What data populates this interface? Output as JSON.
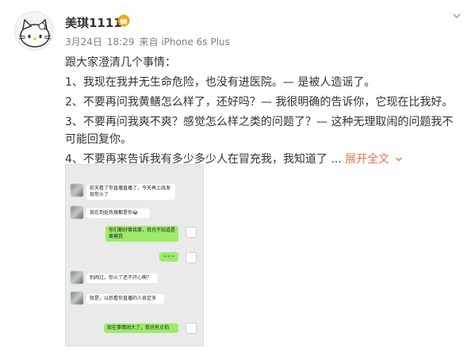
{
  "post": {
    "username": "美琪1111",
    "date": "3月24日",
    "time": "18:29",
    "source": "来自 iPhone 6s Plus",
    "lines": [
      "跟大家澄清几个事情：",
      "1、我现在我并无生命危险，也没有进医院。— 是被人造谣了。",
      "2、不要再问我黄鳝怎么样了，还好吗？— 我很明确的告诉你，它现在比我好。",
      "3、不要再问我爽不爽？感觉怎么样之类的问题了？— 这种无理取闹的问题我不可能回复你。",
      "4、不要再来告诉我有多少多少人在冒充我，我知道了"
    ],
    "ellipsis": "...",
    "expand_label": "展开全文",
    "icons": {
      "avatar": "hello-kitty-avatar-icon",
      "badge": "vip-crown-icon",
      "menu": "chevron-down-icon",
      "expand": "chevron-down-icon"
    },
    "colors": {
      "link": "#eb7350",
      "meta": "#808080",
      "text": "#333333"
    }
  },
  "chat": {
    "messages": [
      {
        "side": "in",
        "text": "前天看了你直播直播了，今天再上线发现你火了"
      },
      {
        "side": "in",
        "text": "现在到处热搜都是你😂"
      },
      {
        "side": "out",
        "text": "你们都好事找事，我也不知道是黄鳝我"
      },
      {
        "side": "out",
        "text": "~~~"
      },
      {
        "side": "in",
        "text": "别闹过，你火了还不开心啊？"
      },
      {
        "side": "in",
        "text": "就是，以后看你直播的人肯定多"
      },
      {
        "side": "out",
        "text": "现在事情闹大了，我也有点怕"
      }
    ]
  }
}
